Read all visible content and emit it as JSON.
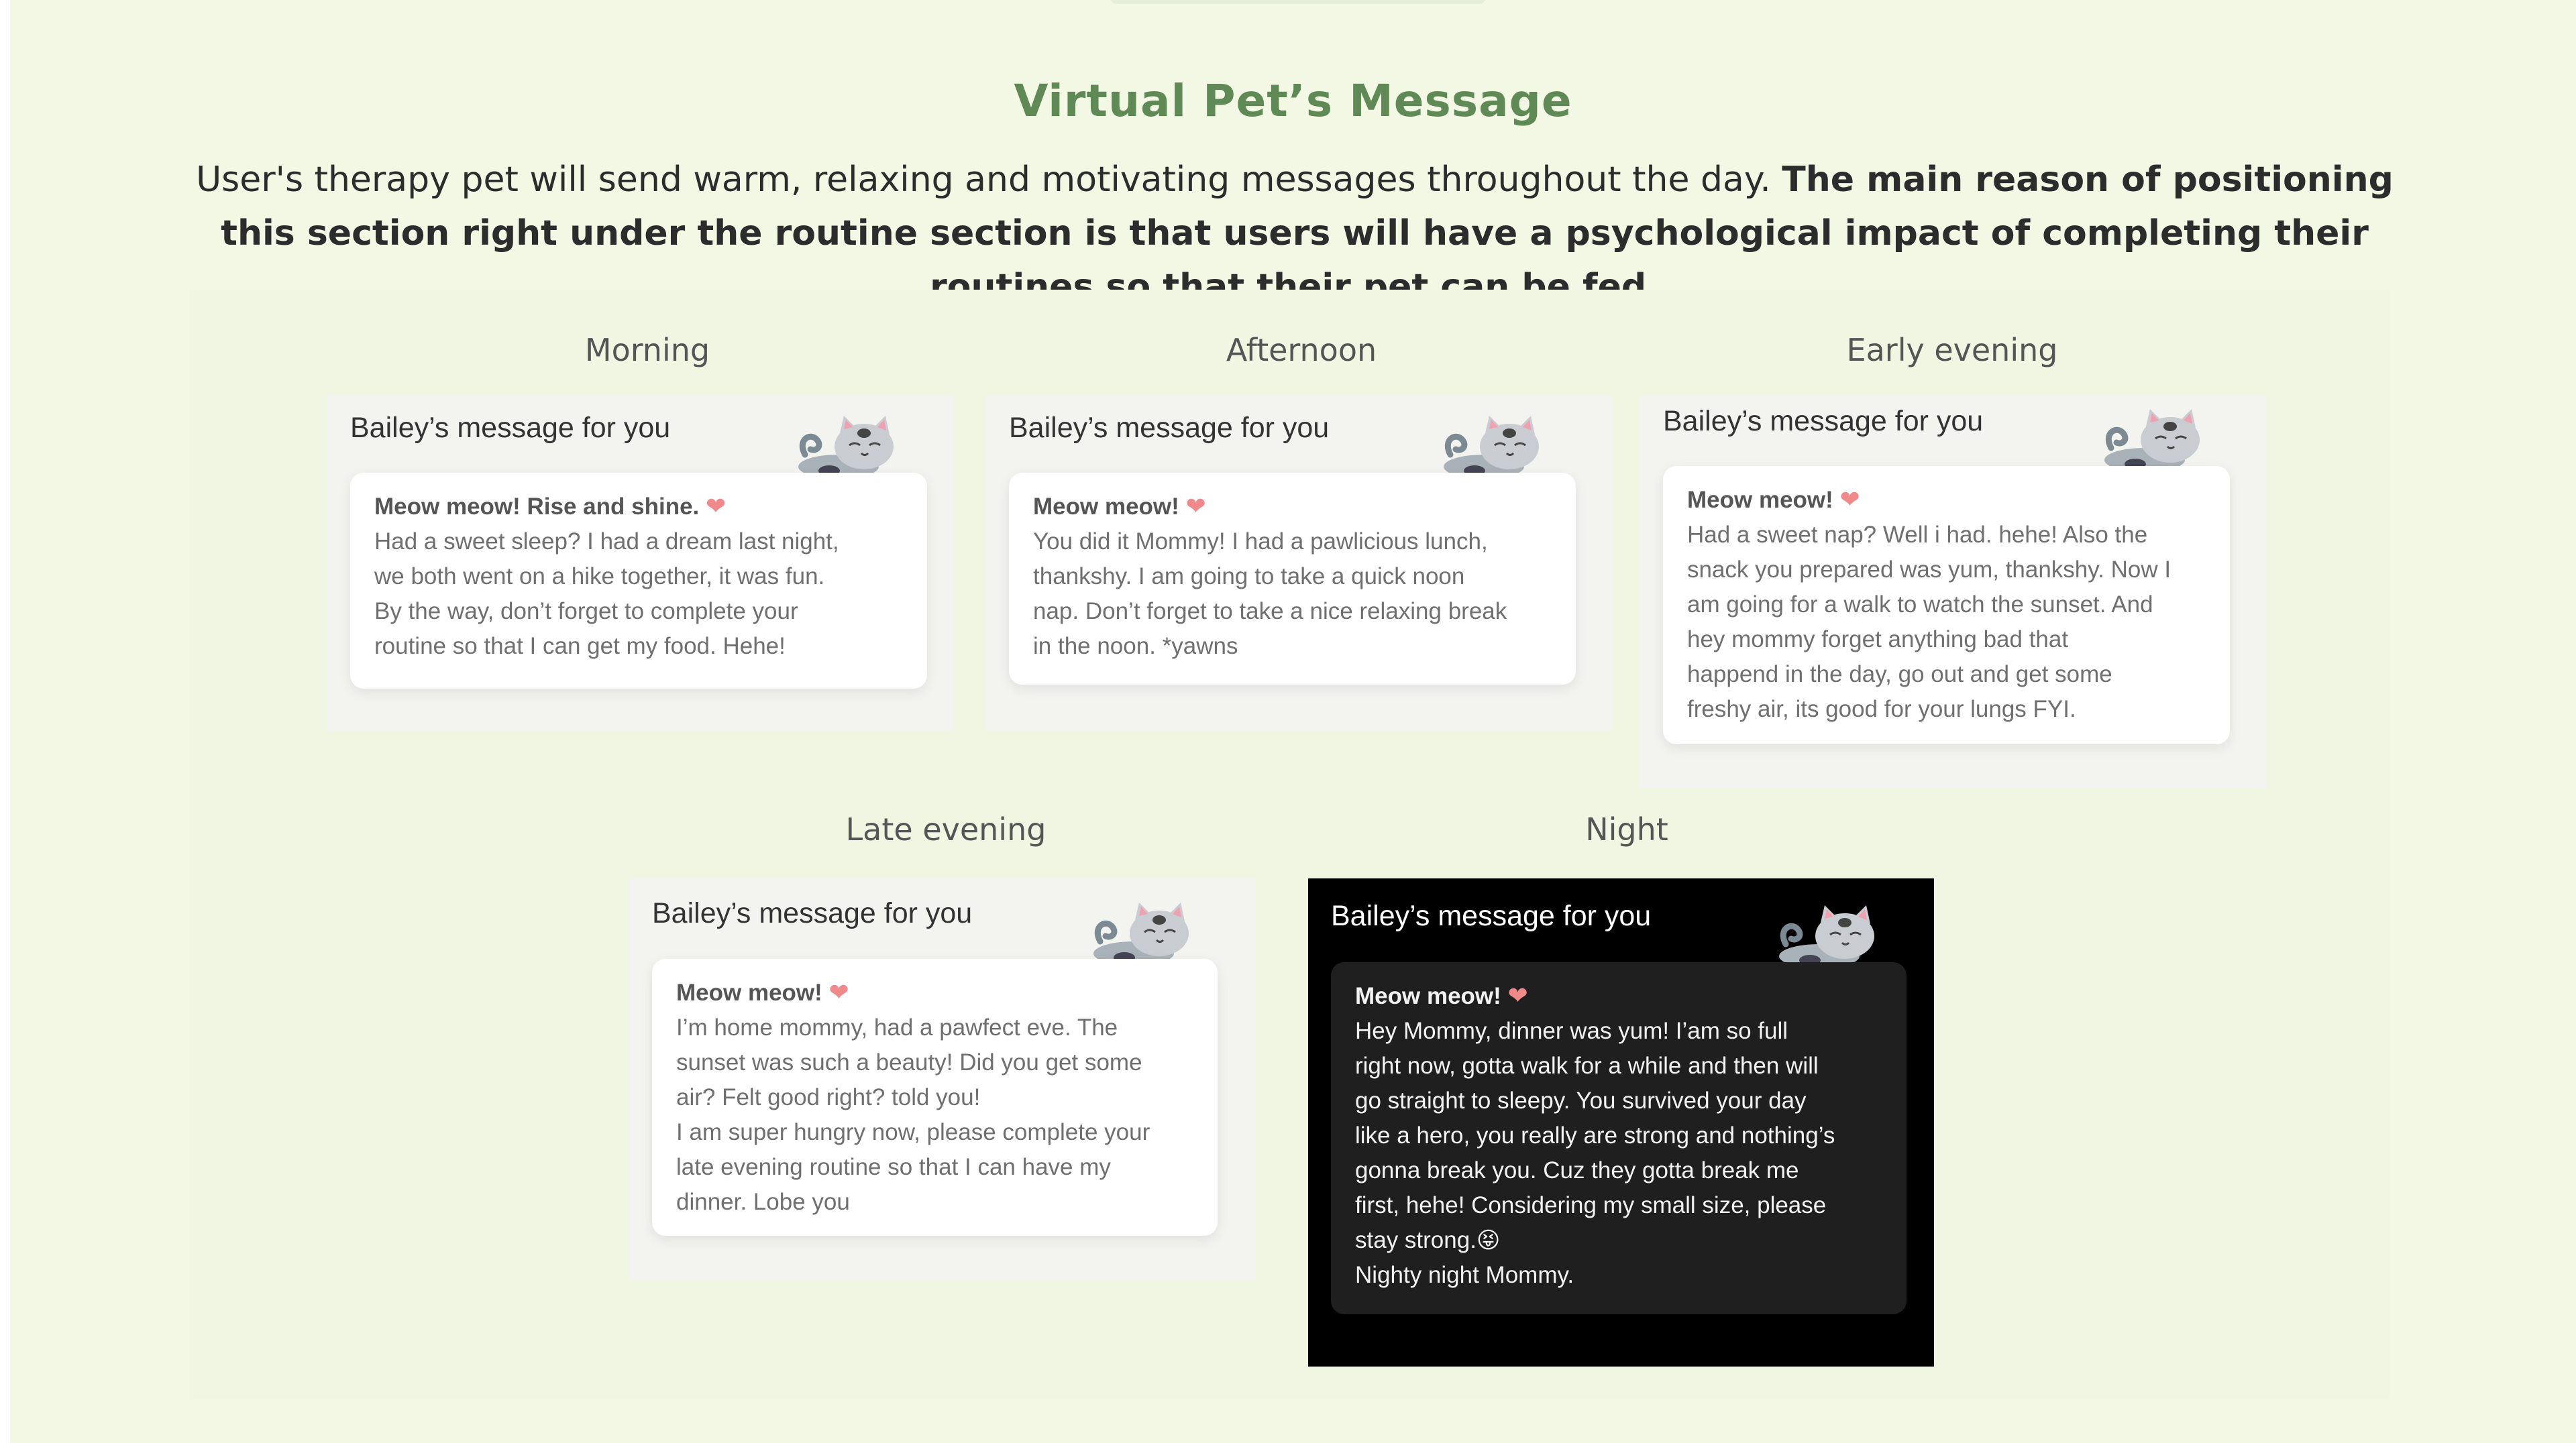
{
  "section": {
    "title": "Virtual Pet’s Message",
    "intro_regular": "User's therapy pet will send warm, relaxing and motivating messages throughout the day. ",
    "intro_bold": "The main reason of positioning this section right under the routine section is that users will have a psychological impact of completing their routines so that their pet can be fed."
  },
  "icons": {
    "heart": "heart-icon",
    "cat": "sleeping-cat-icon",
    "emoji": "tongue-out-emoji"
  },
  "colors": {
    "background": "#f2f8e3",
    "title": "#5f8a55",
    "heart": "#f08a8a",
    "night_card": "#000000"
  },
  "cards": [
    {
      "period": "Morning",
      "heading": "Bailey’s message for you",
      "greeting": "Meow meow! Rise and shine.",
      "heart": "❤",
      "body": "Had a sweet sleep? I had a dream last night,\nwe both went on a hike together, it was fun.\nBy the way, don’t forget to complete your\nroutine so that I can get my food. Hehe!"
    },
    {
      "period": "Afternoon",
      "heading": "Bailey’s message for you",
      "greeting": "Meow meow!",
      "heart": "❤",
      "body": "You did it Mommy! I had a pawlicious lunch,\nthankshy. I am going to take a quick noon\nnap. Don’t forget to take a nice relaxing break\nin the noon. *yawns"
    },
    {
      "period": "Early evening",
      "heading": "Bailey’s message for you",
      "greeting": "Meow meow!",
      "heart": "❤",
      "body": "Had a sweet nap? Well i had. hehe! Also the\nsnack you prepared was yum, thankshy. Now I\nam going for a walk to watch the sunset. And\nhey mommy forget anything bad that\nhappend in the day, go out and get some\nfreshy air, its good for your lungs FYI."
    },
    {
      "period": "Late evening",
      "heading": "Bailey’s message for you",
      "greeting": "Meow meow!",
      "heart": "❤",
      "body": "I’m home mommy, had a pawfect eve. The\nsunset was such a beauty! Did you get some\nair? Felt good right? told you!\nI am super hungry now, please complete your\nlate evening routine so that I can have my\ndinner. Lobe you"
    },
    {
      "period": "Night",
      "heading": "Bailey’s message for you",
      "greeting": "Meow meow!",
      "heart": "❤",
      "body": "Hey Mommy, dinner was yum! I’am so full\nright now, gotta walk for a while and then will\ngo straight to sleepy. You survived your day\nlike a hero, you really are strong and nothing’s\ngonna break you. Cuz they gotta break me\nfirst, hehe! Considering my small size, please\nstay strong.",
      "emoji": "😝",
      "closing": "Nighty night Mommy."
    }
  ]
}
